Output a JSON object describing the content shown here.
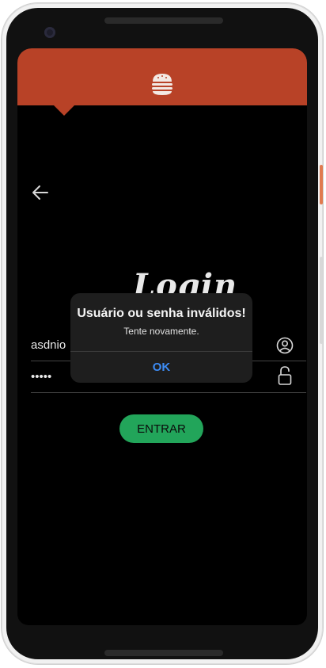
{
  "login": {
    "title": "Login",
    "username_value": "asdnio",
    "password_value": "•••••",
    "submit_label": "ENTRAR"
  },
  "dialog": {
    "title": "Usuário ou senha inválidos!",
    "message": "Tente novamente.",
    "ok_label": "OK"
  },
  "colors": {
    "header": "#b84227",
    "button": "#22a55a",
    "dialog_action": "#3d8cf5",
    "background": "#000000"
  },
  "icons": {
    "header": "burger-icon",
    "back": "arrow-left-icon",
    "username": "user-circle-icon",
    "password": "lock-icon"
  }
}
